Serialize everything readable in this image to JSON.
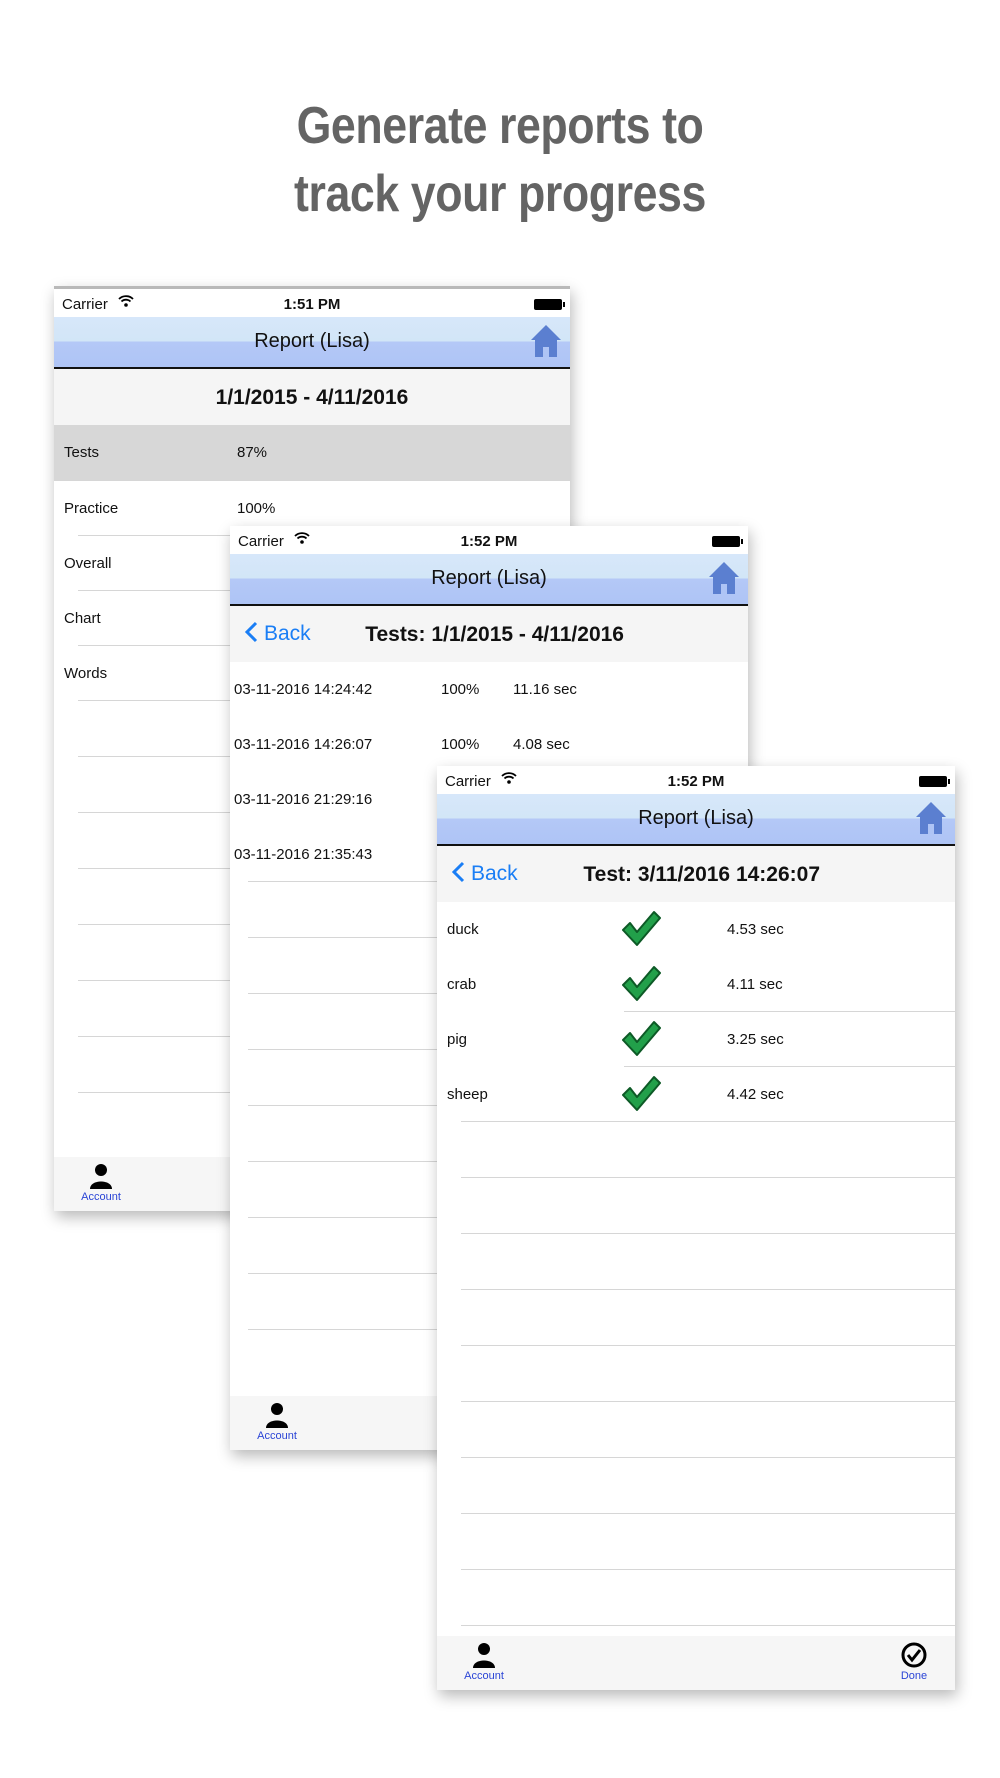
{
  "headline": {
    "line1": "Generate reports to",
    "line2": "track your progress"
  },
  "screen1": {
    "status": {
      "carrier": "Carrier",
      "time": "1:51 PM"
    },
    "nav_title": "Report (Lisa)",
    "date_range": "1/1/2015 - 4/11/2016",
    "rows": [
      {
        "label": "Tests",
        "value": "87%"
      },
      {
        "label": "Practice",
        "value": "100%"
      },
      {
        "label": "Overall",
        "value": ""
      },
      {
        "label": "Chart",
        "value": ""
      },
      {
        "label": "Words",
        "value": ""
      }
    ],
    "tab_account": "Account"
  },
  "screen2": {
    "status": {
      "carrier": "Carrier",
      "time": "1:52 PM"
    },
    "nav_title": "Report (Lisa)",
    "back_label": "Back",
    "title": "Tests: 1/1/2015 - 4/11/2016",
    "rows": [
      {
        "datetime": "03-11-2016 14:24:42",
        "score": "100%",
        "time": "11.16 sec"
      },
      {
        "datetime": "03-11-2016 14:26:07",
        "score": "100%",
        "time": "4.08 sec"
      },
      {
        "datetime": "03-11-2016 21:29:16",
        "score": "",
        "time": ""
      },
      {
        "datetime": "03-11-2016 21:35:43",
        "score": "",
        "time": ""
      }
    ],
    "tab_account": "Account"
  },
  "screen3": {
    "status": {
      "carrier": "Carrier",
      "time": "1:52 PM"
    },
    "nav_title": "Report (Lisa)",
    "back_label": "Back",
    "title": "Test: 3/11/2016 14:26:07",
    "rows": [
      {
        "word": "duck",
        "correct": true,
        "time": "4.53 sec"
      },
      {
        "word": "crab",
        "correct": true,
        "time": "4.11 sec"
      },
      {
        "word": "pig",
        "correct": true,
        "time": "3.25 sec"
      },
      {
        "word": "sheep",
        "correct": true,
        "time": "4.42 sec"
      }
    ],
    "tab_account": "Account",
    "tab_done": "Done"
  },
  "colors": {
    "accent": "#1a7ef5",
    "tab_text": "#2a44d6",
    "check_green": "#22a04a",
    "home_icon": "#5b7fd0"
  },
  "icons": [
    "wifi-icon",
    "battery-icon",
    "home-icon",
    "chevron-left-icon",
    "account-icon",
    "checkmark-icon",
    "done-icon"
  ]
}
